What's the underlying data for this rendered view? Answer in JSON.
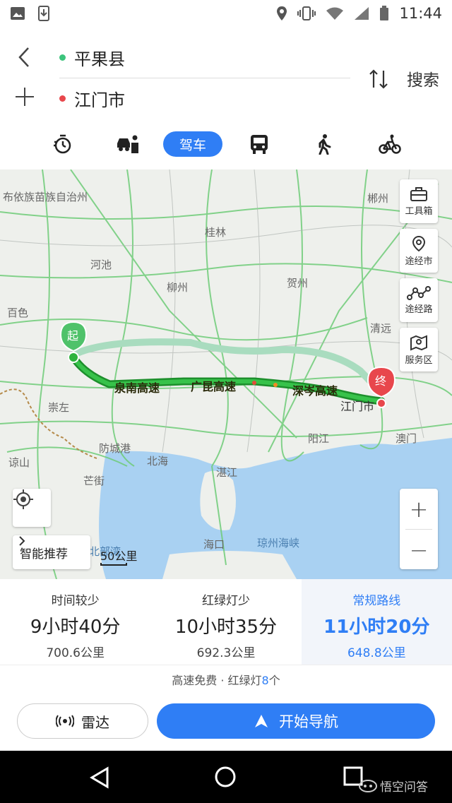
{
  "status_bar": {
    "time": "11:44"
  },
  "route": {
    "start": "平果县",
    "end": "江门市",
    "search_label": "搜索",
    "start_color": "#3cc47c",
    "end_color": "#e8474c"
  },
  "modes": {
    "items": [
      "taxi-timer",
      "ride-hailing",
      "驾车",
      "bus",
      "walk",
      "bike"
    ],
    "active_label": "驾车"
  },
  "map": {
    "labels": {
      "region_top": "布依族苗族自治州",
      "chenzhou": "郴州",
      "guilin": "桂林",
      "hechi": "河池",
      "liuzhou": "柳州",
      "hezhou": "贺州",
      "baise": "百色",
      "qingyuan": "清远",
      "chongzuo": "崇左",
      "fangchenggang": "防城港",
      "beihai": "北海",
      "zhanjiang": "湛江",
      "yangjiang": "阳江",
      "aomen": "澳门",
      "liangshan": "谅山",
      "mangjie": "芒街",
      "haikou": "海口",
      "strait": "琼州海峡",
      "beibu": "北部湾",
      "jiangmen": "江门市"
    },
    "highways": [
      "泉南高速",
      "广昆高速",
      "深岑高速"
    ],
    "start_marker": "起",
    "end_marker": "终",
    "tools": [
      "工具箱",
      "途经市",
      "途经路",
      "服务区"
    ],
    "recommend": "智能推荐",
    "scale": "50公里",
    "zoom_in": "+",
    "zoom_out": "−"
  },
  "route_options": [
    {
      "label": "时间较少",
      "duration": "9小时40分",
      "distance": "700.6公里",
      "selected": false
    },
    {
      "label": "红绿灯少",
      "duration": "10小时35分",
      "distance": "692.3公里",
      "selected": false
    },
    {
      "label": "常规路线",
      "duration": "11小时20分",
      "distance": "648.8公里",
      "selected": true
    }
  ],
  "route_info": {
    "prefix": "高速免费 · 红绿灯",
    "lights": "8",
    "suffix": "个"
  },
  "actions": {
    "radar": "雷达",
    "navigate": "开始导航"
  },
  "watermark": "悟空问答",
  "colors": {
    "accent": "#2f7ef5",
    "route_main": "#2db33d",
    "route_alt": "#a9dcbf"
  }
}
